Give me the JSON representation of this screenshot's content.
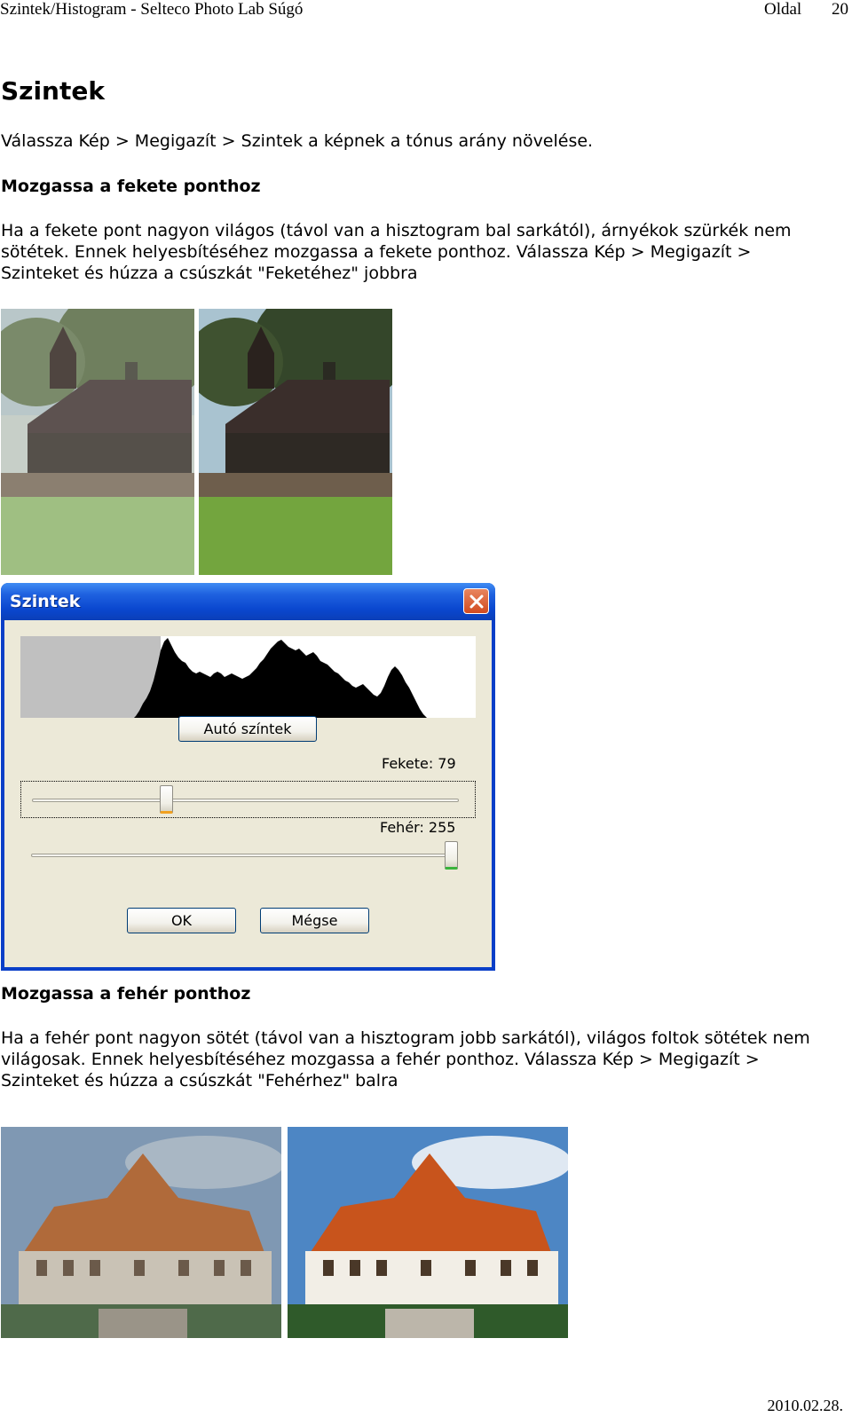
{
  "header": {
    "title": "Szintek/Histogram - Selteco Photo Lab Súgó",
    "page_label": "Oldal",
    "page_number": "20"
  },
  "heading": "Szintek",
  "intro": "Válassza Kép > Megigazít > Szintek a képnek a tónus arány növelése.",
  "section1": {
    "title": "Mozgassa a fekete ponthoz",
    "lines": [
      "Ha a fekete pont nagyon világos (távol van a hisztogram bal sarkától), árnyékok szürkék nem",
      "sötétek. Ennek helyesbítéséhez mozgassa a fekete ponthoz. Válassza Kép > Megigazít >",
      "Szinteket és húzza a csúszkát \"Feketéhez\" jobbra"
    ]
  },
  "dialog": {
    "title": "Szintek",
    "auto_button": "Autó színtek",
    "black_label": "Fekete: 79",
    "white_label": "Fehér: 255",
    "black_value": 79,
    "white_value": 255,
    "ok_button": "OK",
    "cancel_button": "Mégse"
  },
  "section2": {
    "title": "Mozgassa a fehér ponthoz",
    "lines": [
      "Ha a fehér pont nagyon sötét (távol van a hisztogram jobb sarkától), világos foltok sötétek nem",
      "világosak. Ennek helyesbítéséhez mozgassa a fehér ponthoz. Válassza Kép > Megigazít >",
      "Szinteket és húzza a csúszkát \"Fehérhez\" balra"
    ]
  },
  "footer": {
    "date": "2010.02.28."
  },
  "colors": {
    "xp_blue": "#0a47cf",
    "dialog_face": "#ece9d8",
    "close_red": "#d24b20"
  },
  "icons": [
    "close-icon"
  ]
}
